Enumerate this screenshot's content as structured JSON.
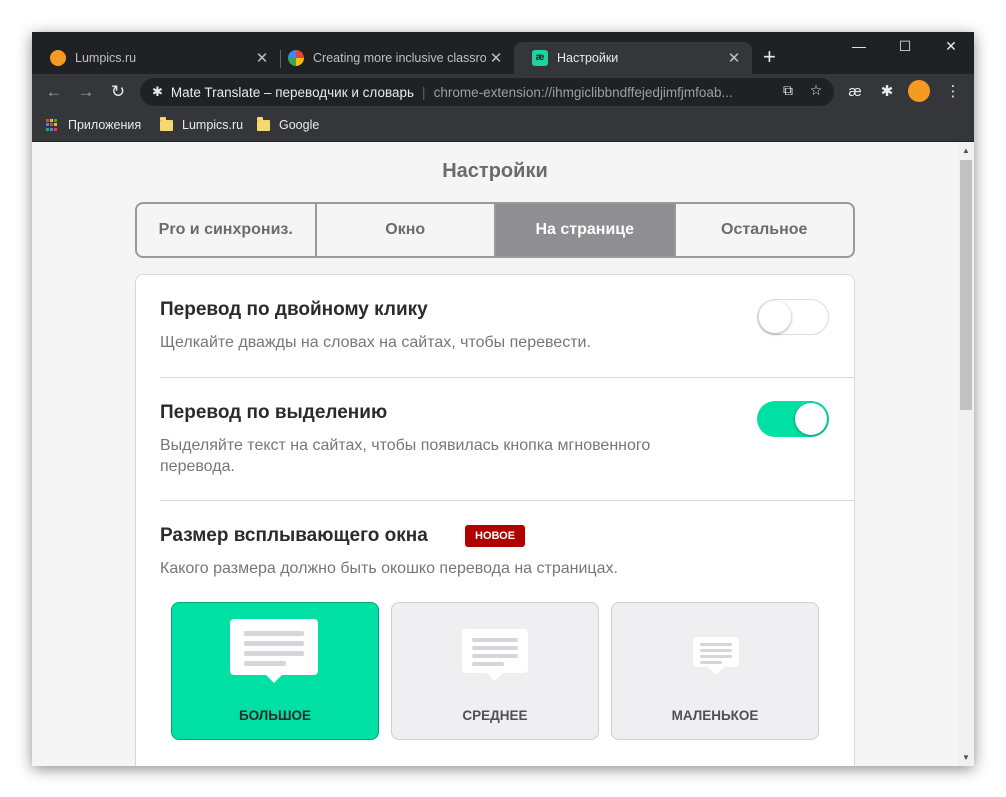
{
  "tabs": [
    {
      "title": "Lumpics.ru",
      "icon": "orange-icon"
    },
    {
      "title": "Creating more inclusive classroom",
      "icon": "google-icon"
    },
    {
      "title": "Настройки",
      "icon": "mate-translate-icon"
    }
  ],
  "omnibox": {
    "site": "Mate Translate – переводчик и словарь",
    "url": "chrome-extension://ihmgiclibbndffejedjimfjmfoab..."
  },
  "bookmarks": [
    {
      "label": "Приложения"
    },
    {
      "label": "Lumpics.ru"
    },
    {
      "label": "Google"
    }
  ],
  "page": {
    "title": "Настройки",
    "tabs": [
      "Pro и синхрониз.",
      "Окно",
      "На странице",
      "Остальное"
    ],
    "active_tab": "На странице"
  },
  "settings": {
    "double_click": {
      "title": "Перевод по двойному клику",
      "desc": "Щелкайте дважды на словах на сайтах, чтобы перевести.",
      "enabled": false
    },
    "selection": {
      "title": "Перевод по выделению",
      "desc": "Выделяйте текст на сайтах, чтобы появилась кнопка мгновенного перевода.",
      "enabled": true
    },
    "popup_size": {
      "title": "Размер всплывающего окна",
      "badge": "НОВОЕ",
      "desc": "Какого размера должно быть окошко перевода на страницах.",
      "options": [
        "БОЛЬШОЕ",
        "СРЕДНЕЕ",
        "МАЛЕНЬКОЕ"
      ],
      "selected": "БОЛЬШОЕ"
    }
  },
  "colors": {
    "accent": "#00e0a4",
    "badge": "#b00000",
    "tab_active": "#8f8f93",
    "chrome_dark": "#202124",
    "chrome_toolbar": "#35363a"
  }
}
